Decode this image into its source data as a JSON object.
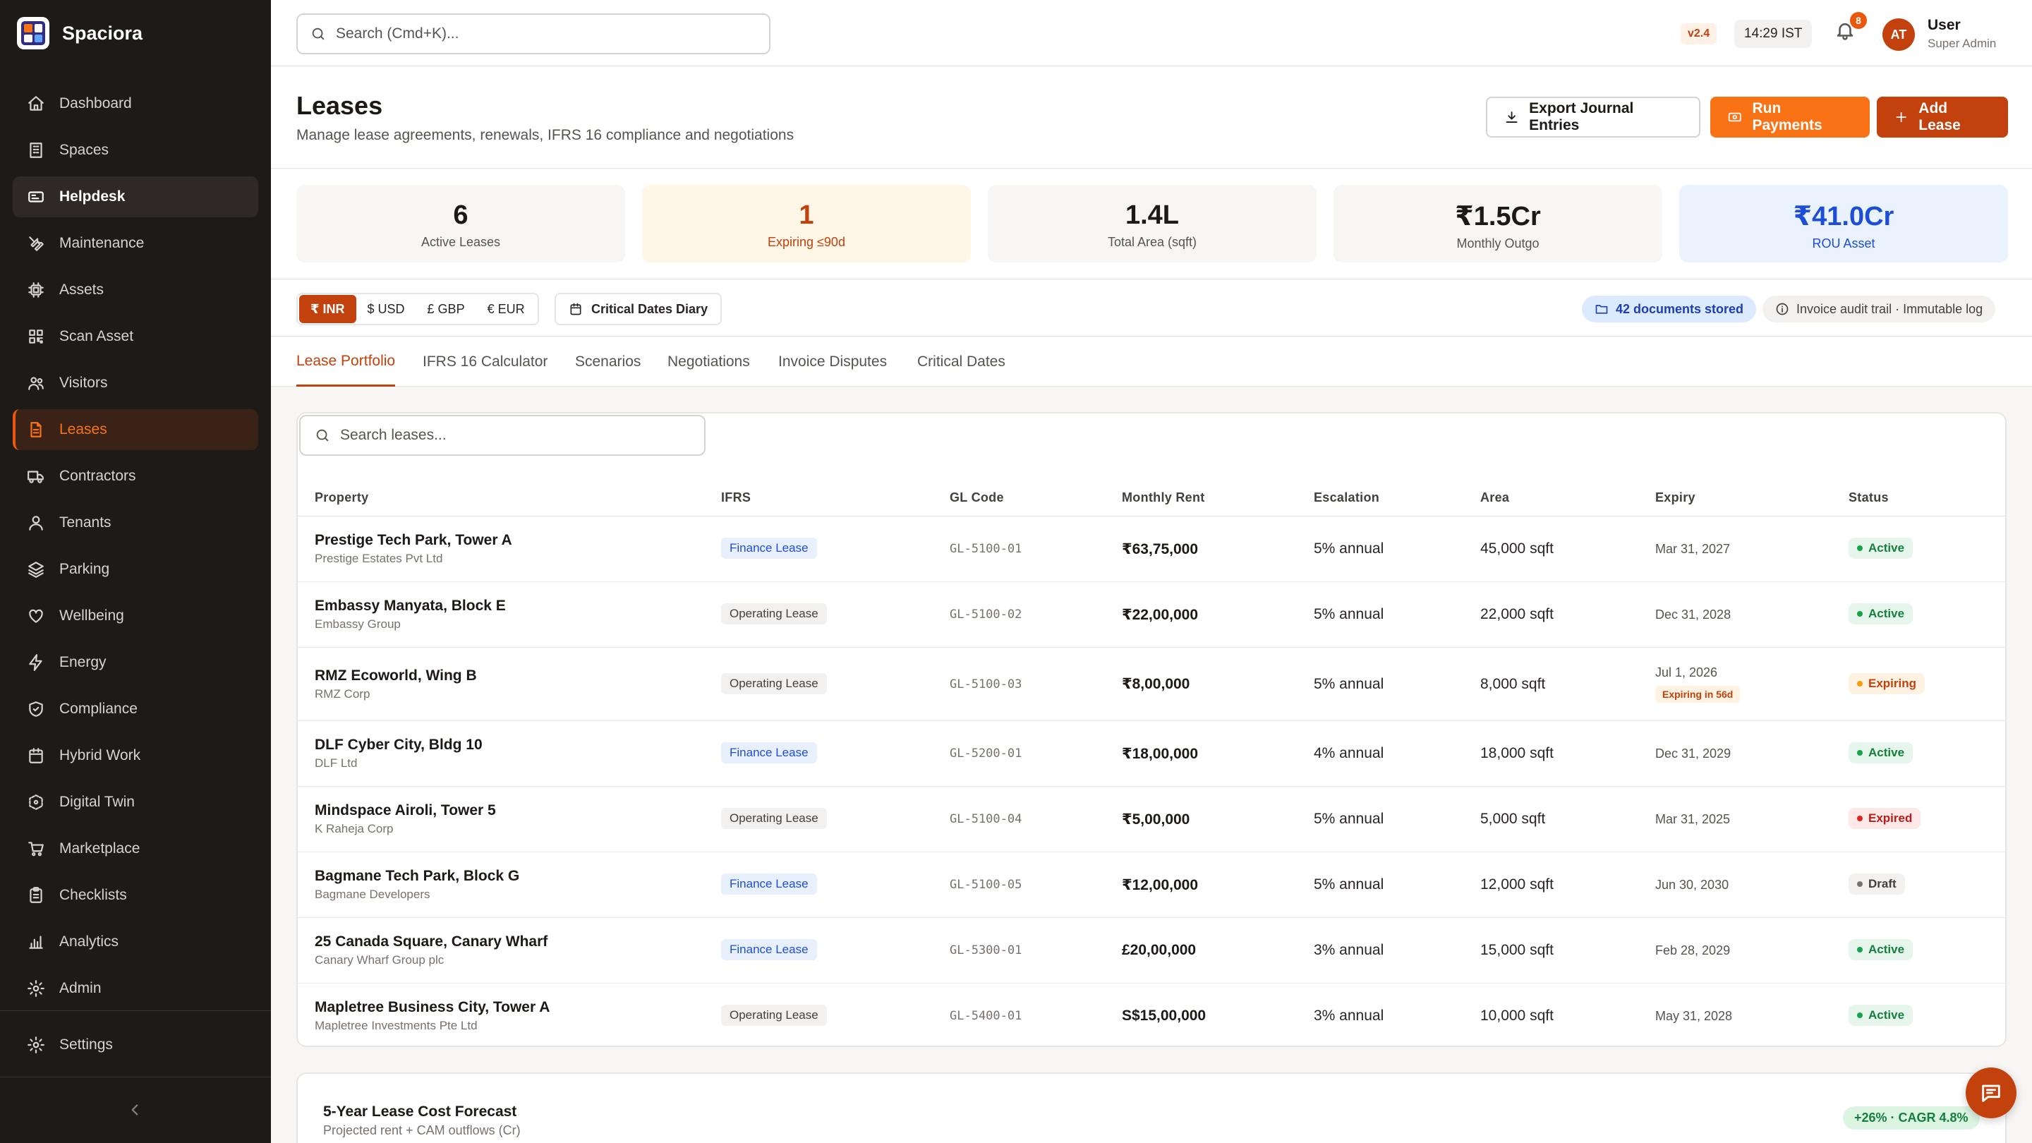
{
  "app": {
    "name": "Spaciora"
  },
  "sidebar": {
    "items": [
      {
        "label": "Dashboard",
        "icon": "home-icon"
      },
      {
        "label": "Spaces",
        "icon": "building-icon"
      },
      {
        "label": "Helpdesk",
        "icon": "ticket-icon"
      },
      {
        "label": "Maintenance",
        "icon": "wrench-icon"
      },
      {
        "label": "Assets",
        "icon": "chip-icon"
      },
      {
        "label": "Scan Asset",
        "icon": "qr-icon"
      },
      {
        "label": "Visitors",
        "icon": "users-icon"
      },
      {
        "label": "Leases",
        "icon": "document-icon"
      },
      {
        "label": "Contractors",
        "icon": "truck-icon"
      },
      {
        "label": "Tenants",
        "icon": "person-icon"
      },
      {
        "label": "Parking",
        "icon": "layers-icon"
      },
      {
        "label": "Wellbeing",
        "icon": "heart-icon"
      },
      {
        "label": "Energy",
        "icon": "bolt-icon"
      },
      {
        "label": "Compliance",
        "icon": "shield-icon"
      },
      {
        "label": "Hybrid Work",
        "icon": "calendar-icon"
      },
      {
        "label": "Digital Twin",
        "icon": "cube-icon"
      },
      {
        "label": "Marketplace",
        "icon": "cart-icon"
      },
      {
        "label": "Checklists",
        "icon": "clipboard-icon"
      },
      {
        "label": "Analytics",
        "icon": "bar-chart-icon"
      },
      {
        "label": "Admin",
        "icon": "gear-icon"
      }
    ],
    "settings": "Settings"
  },
  "topbar": {
    "search_placeholder": "Search (Cmd+K)...",
    "version": "v2.4",
    "time": "14:29 IST",
    "notifications": "8",
    "avatar_initials": "AT",
    "user_name": "User",
    "user_role": "Super Admin"
  },
  "header": {
    "title": "Leases",
    "subtitle": "Manage lease agreements, renewals, IFRS 16 compliance and negotiations",
    "export_label": "Export Journal Entries",
    "run_label": "Run Payments",
    "add_label": "Add Lease"
  },
  "stats": [
    {
      "value": "6",
      "label": "Active Leases"
    },
    {
      "value": "1",
      "label": "Expiring ≤90d"
    },
    {
      "value": "1.4L",
      "label": "Total Area (sqft)"
    },
    {
      "value": "₹1.5Cr",
      "label": "Monthly Outgo"
    },
    {
      "value": "₹41.0Cr",
      "label": "ROU Asset"
    }
  ],
  "filters": {
    "currencies": [
      "₹ INR",
      "$ USD",
      "£ GBP",
      "€ EUR"
    ],
    "diary_label": "Critical Dates Diary",
    "docs_label": "42 documents stored",
    "audit_label": "Invoice audit trail · Immutable log"
  },
  "tabs": [
    "Lease Portfolio",
    "IFRS 16 Calculator",
    "Scenarios",
    "Negotiations",
    "Invoice Disputes",
    "Critical Dates"
  ],
  "table": {
    "search_placeholder": "Search leases...",
    "headers": [
      "Property",
      "IFRS",
      "GL Code",
      "Monthly Rent",
      "Escalation",
      "Area",
      "Expiry",
      "Status"
    ],
    "rows": [
      {
        "property": "Prestige Tech Park, Tower A",
        "org": "Prestige Estates Pvt Ltd",
        "ifrs": "Finance Lease",
        "gl": "GL-5100-01",
        "rent": "₹63,75,000",
        "escalation": "5% annual",
        "area": "45,000 sqft",
        "expiry": "Mar 31, 2027",
        "expiry_note": "",
        "status": "Active"
      },
      {
        "property": "Embassy Manyata, Block E",
        "org": "Embassy Group",
        "ifrs": "Operating Lease",
        "gl": "GL-5100-02",
        "rent": "₹22,00,000",
        "escalation": "5% annual",
        "area": "22,000 sqft",
        "expiry": "Dec 31, 2028",
        "expiry_note": "",
        "status": "Active"
      },
      {
        "property": "RMZ Ecoworld, Wing B",
        "org": "RMZ Corp",
        "ifrs": "Operating Lease",
        "gl": "GL-5100-03",
        "rent": "₹8,00,000",
        "escalation": "5% annual",
        "area": "8,000 sqft",
        "expiry": "Jul 1, 2026",
        "expiry_note": "Expiring in 56d",
        "status": "Expiring"
      },
      {
        "property": "DLF Cyber City, Bldg 10",
        "org": "DLF Ltd",
        "ifrs": "Finance Lease",
        "gl": "GL-5200-01",
        "rent": "₹18,00,000",
        "escalation": "4% annual",
        "area": "18,000 sqft",
        "expiry": "Dec 31, 2029",
        "expiry_note": "",
        "status": "Active"
      },
      {
        "property": "Mindspace Airoli, Tower 5",
        "org": "K Raheja Corp",
        "ifrs": "Operating Lease",
        "gl": "GL-5100-04",
        "rent": "₹5,00,000",
        "escalation": "5% annual",
        "area": "5,000 sqft",
        "expiry": "Mar 31, 2025",
        "expiry_note": "",
        "status": "Expired"
      },
      {
        "property": "Bagmane Tech Park, Block G",
        "org": "Bagmane Developers",
        "ifrs": "Finance Lease",
        "gl": "GL-5100-05",
        "rent": "₹12,00,000",
        "escalation": "5% annual",
        "area": "12,000 sqft",
        "expiry": "Jun 30, 2030",
        "expiry_note": "",
        "status": "Draft"
      },
      {
        "property": "25 Canada Square, Canary Wharf",
        "org": "Canary Wharf Group plc",
        "ifrs": "Finance Lease",
        "gl": "GL-5300-01",
        "rent": "£20,00,000",
        "escalation": "3% annual",
        "area": "15,000 sqft",
        "expiry": "Feb 28, 2029",
        "expiry_note": "",
        "status": "Active"
      },
      {
        "property": "Mapletree Business City, Tower A",
        "org": "Mapletree Investments Pte Ltd",
        "ifrs": "Operating Lease",
        "gl": "GL-5400-01",
        "rent": "S$15,00,000",
        "escalation": "3% annual",
        "area": "10,000 sqft",
        "expiry": "May 31, 2028",
        "expiry_note": "",
        "status": "Active"
      }
    ]
  },
  "forecast": {
    "title": "5-Year Lease Cost Forecast",
    "subtitle": "Projected rent + CAM outflows (Cr)",
    "badge": "+26% · CAGR 4.8%"
  },
  "colors": {
    "accent": "#c2410c",
    "orange": "#f97316",
    "sidebar_bg": "#1e1a18"
  }
}
